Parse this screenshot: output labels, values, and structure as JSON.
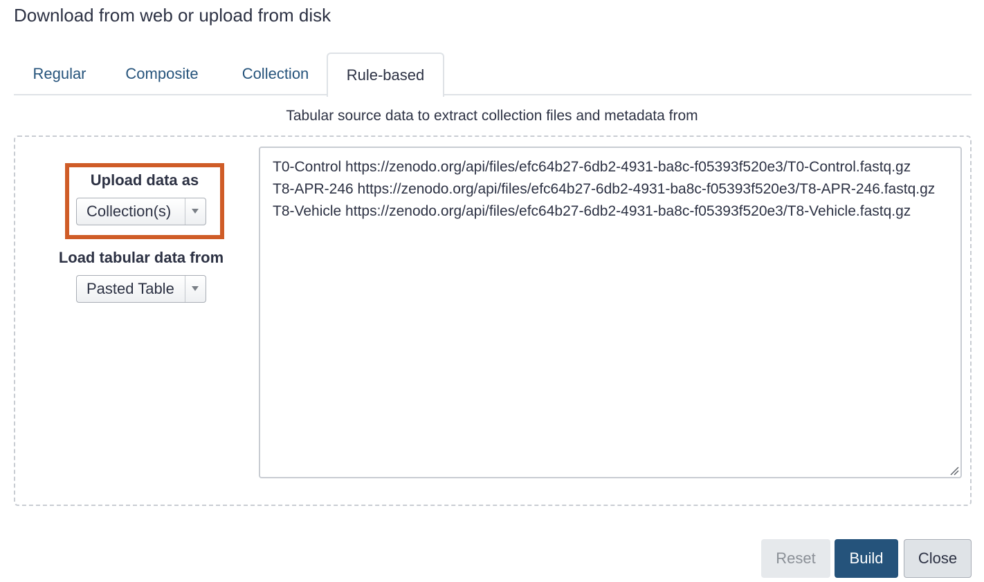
{
  "dialog": {
    "title": "Download from web or upload from disk"
  },
  "tabs": [
    {
      "label": "Regular"
    },
    {
      "label": "Composite"
    },
    {
      "label": "Collection"
    },
    {
      "label": "Rule-based",
      "active": true
    }
  ],
  "main": {
    "subtitle": "Tabular source data to extract collection files and metadata from",
    "upload_as": {
      "label": "Upload data as",
      "value": "Collection(s)"
    },
    "load_from": {
      "label": "Load tabular data from",
      "value": "Pasted Table"
    },
    "pasted_lines": [
      "T0-Control https://zenodo.org/api/files/efc64b27-6db2-4931-ba8c-f05393f520e3/T0-Control.fastq.gz",
      "T8-APR-246 https://zenodo.org/api/files/efc64b27-6db2-4931-ba8c-f05393f520e3/T8-APR-246.fastq.gz",
      "T8-Vehicle https://zenodo.org/api/files/efc64b27-6db2-4931-ba8c-f05393f520e3/T8-Vehicle.fastq.gz"
    ]
  },
  "footer": {
    "reset_label": "Reset",
    "build_label": "Build",
    "close_label": "Close"
  },
  "colors": {
    "highlight": "#cf5c27",
    "primary": "#25537b",
    "link": "#25537b"
  }
}
